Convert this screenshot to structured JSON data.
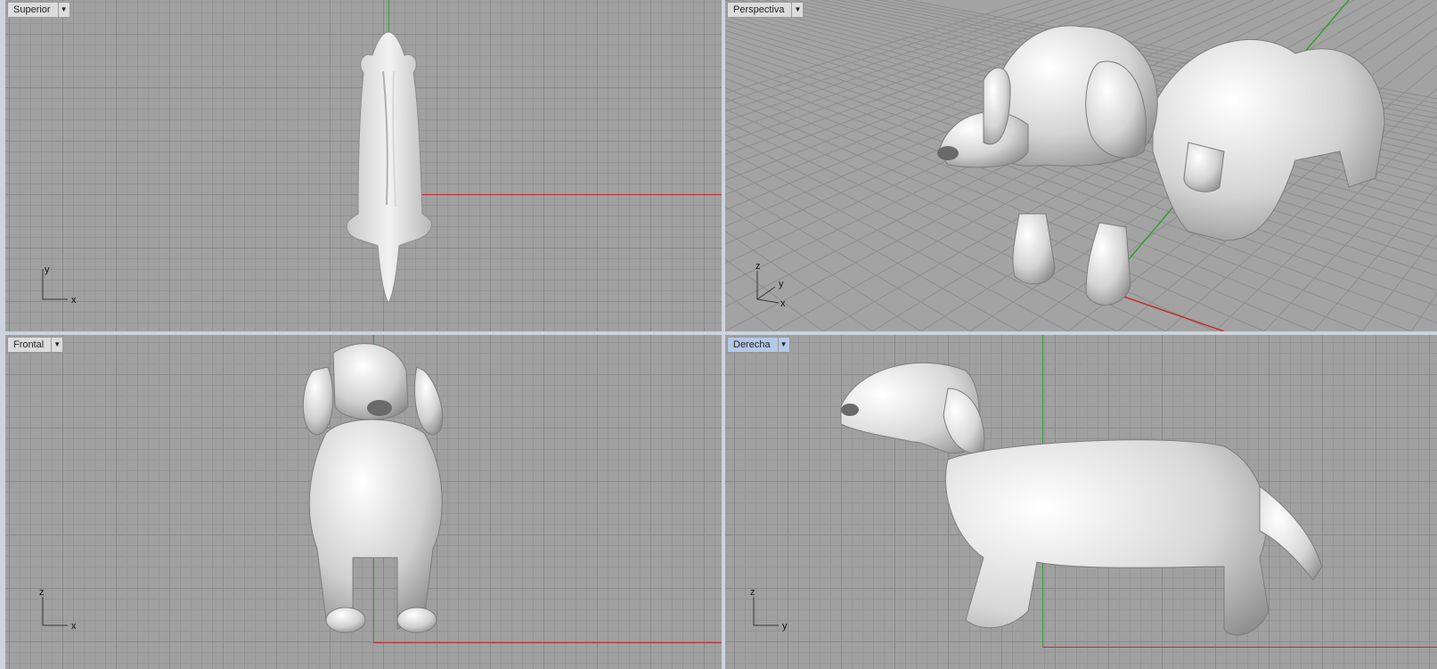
{
  "viewports": {
    "top": {
      "label": "Superior",
      "axis_labels": {
        "a": "y",
        "b": "x"
      }
    },
    "perspective": {
      "label": "Perspectiva",
      "axis_labels": {
        "a": "z",
        "b": "y",
        "c": "x"
      }
    },
    "front": {
      "label": "Frontal",
      "axis_labels": {
        "a": "z",
        "b": "x"
      }
    },
    "right": {
      "label": "Derecha",
      "axis_labels": {
        "a": "z",
        "b": "y"
      }
    }
  },
  "dropdown_glyph": "▼",
  "colors": {
    "grid_bg": "#a0a0a0",
    "x_axis": "#c03030",
    "y_axis": "#30a030",
    "active_label": "#b5c9e6"
  },
  "active_viewport": "right"
}
